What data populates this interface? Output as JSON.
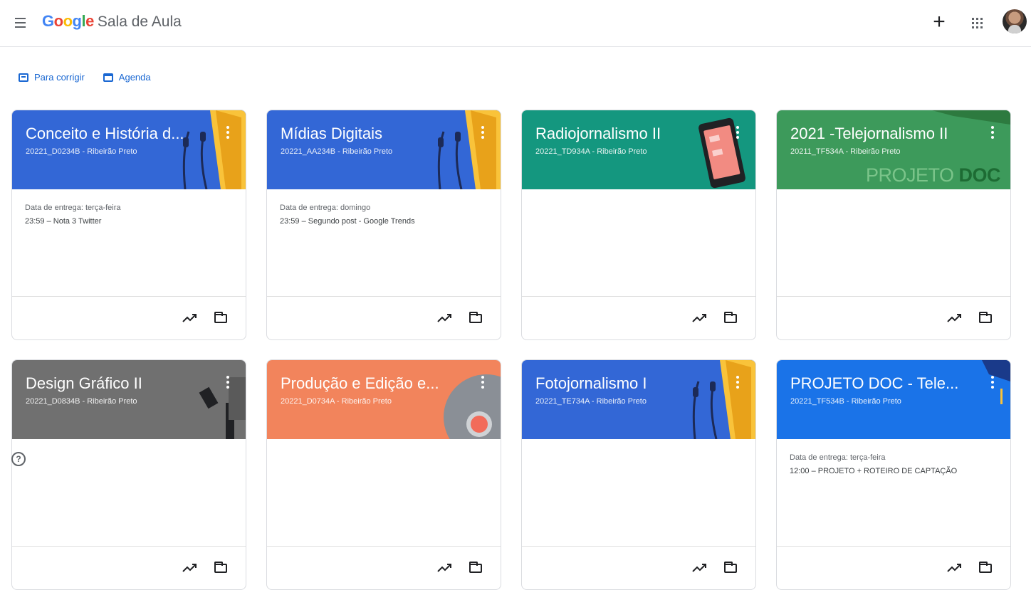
{
  "header": {
    "brand_google": [
      "G",
      "o",
      "o",
      "g",
      "l",
      "e"
    ],
    "brand_colors": [
      "#4285f4",
      "#ea4335",
      "#fbbc05",
      "#4285f4",
      "#34a853",
      "#ea4335"
    ],
    "app_title": "Sala de Aula",
    "add_icon": "+",
    "apps_icon": "apps-grid-icon",
    "avatar_icon": "user-avatar"
  },
  "quicklinks": [
    {
      "label": "Para corrigir",
      "icon": "tray-icon"
    },
    {
      "label": "Agenda",
      "icon": "calendar-icon"
    }
  ],
  "cards": [
    {
      "title": "Conceito e História d...",
      "subtitle": "20221_D0234B - Ribeirão Preto",
      "color": "#3367d6",
      "deco": "headphones",
      "due": "Data de entrega: terça-feira",
      "task": "23:59 – Nota 3 Twitter"
    },
    {
      "title": "Mídias Digitais",
      "subtitle": "20221_AA234B - Ribeirão Preto",
      "color": "#3367d6",
      "deco": "headphones",
      "due": "Data de entrega: domingo",
      "task": "23:59 – Segundo post - Google Trends"
    },
    {
      "title": "Radiojornalismo II",
      "subtitle": "20221_TD934A - Ribeirão Preto",
      "color": "#14977f",
      "deco": "phone",
      "due": "",
      "task": ""
    },
    {
      "title": "2021 -Telejornalismo II",
      "subtitle": "20211_TF534A - Ribeirão Preto",
      "color": "#3d9a5b",
      "deco": "projeto",
      "deco_text": [
        "PROJETO",
        "DOC"
      ],
      "due": "",
      "task": ""
    },
    {
      "title": "Design Gráfico II",
      "subtitle": "20221_D0834B - Ribeirão Preto",
      "color": "#707070",
      "deco": "pen",
      "due": "",
      "task": ""
    },
    {
      "title": "Produção e Edição e...",
      "subtitle": "20221_D0734A - Ribeirão Preto",
      "color": "#f2845c",
      "deco": "circle",
      "due": "",
      "task": ""
    },
    {
      "title": "Fotojornalismo I",
      "subtitle": "20221_TE734A - Ribeirão Preto",
      "color": "#3367d6",
      "deco": "headphones",
      "due": "",
      "task": ""
    },
    {
      "title": "PROJETO DOC - Tele...",
      "subtitle": "20221_TF534B - Ribeirão Preto",
      "color": "#1a73e8",
      "deco": "cap",
      "due": "Data de entrega: terça-feira",
      "task": "12:00 – PROJETO + ROTEIRO DE CAPTAÇÃO"
    }
  ],
  "help_icon": "?"
}
